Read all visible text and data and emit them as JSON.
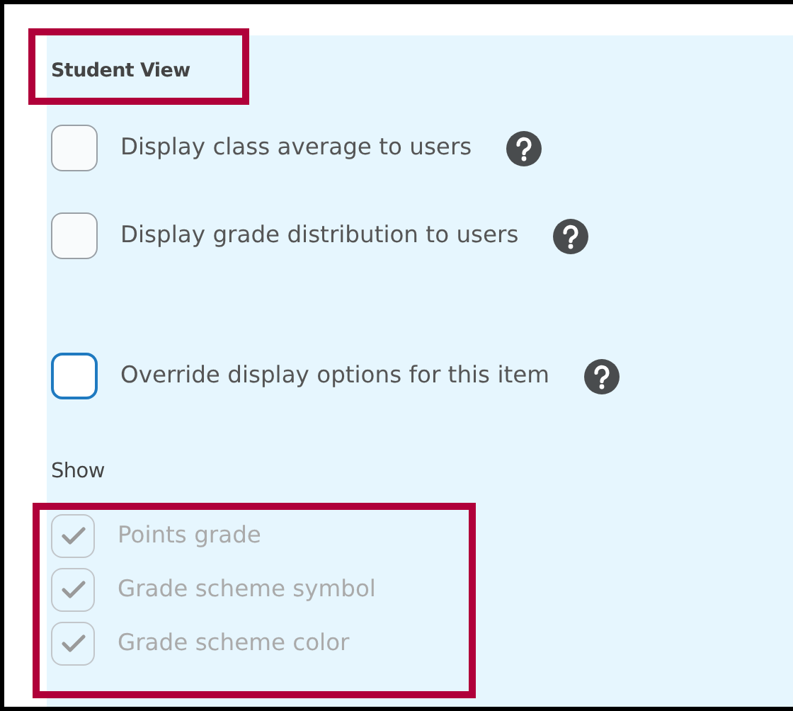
{
  "student_view": {
    "title": "Student View",
    "highlighted": true,
    "options": [
      {
        "label": "Display class average to users",
        "checked": false,
        "focused": false,
        "help": true
      },
      {
        "label": "Display grade distribution to users",
        "checked": false,
        "focused": false,
        "help": true
      },
      {
        "label": "Override display options for this item",
        "checked": false,
        "focused": true,
        "help": true
      }
    ]
  },
  "show": {
    "label": "Show",
    "highlighted": true,
    "options": [
      {
        "label": "Points grade",
        "checked": true,
        "disabled": true
      },
      {
        "label": "Grade scheme symbol",
        "checked": true,
        "disabled": true
      },
      {
        "label": "Grade scheme color",
        "checked": true,
        "disabled": true
      }
    ]
  }
}
